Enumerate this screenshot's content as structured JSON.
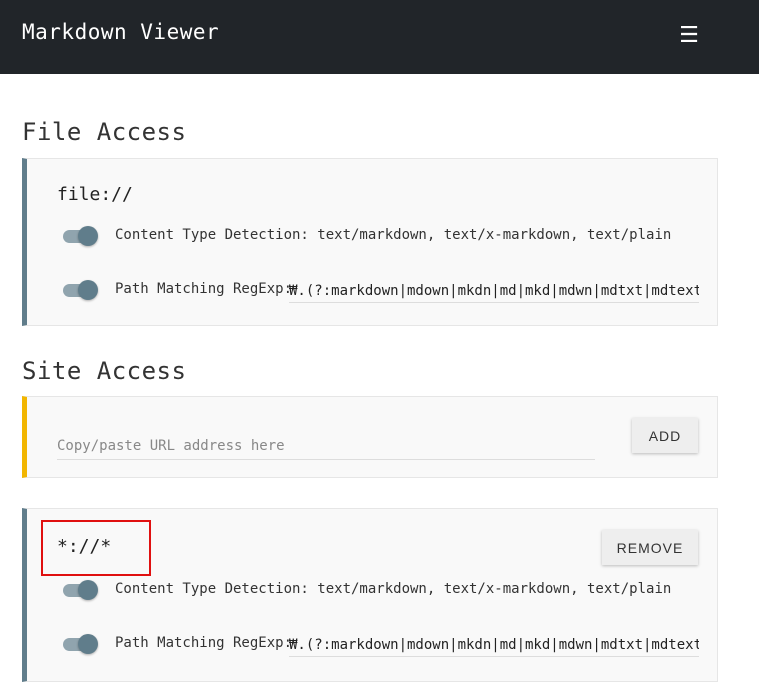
{
  "header": {
    "title": "Markdown Viewer",
    "menu_icon": "hamburger-menu-icon",
    "menu_glyph": "☰"
  },
  "file_access": {
    "title": "File Access",
    "origin": "file://",
    "options": [
      {
        "label": "Content Type Detection: text/markdown, text/x-markdown, text/plain",
        "enabled": true
      },
      {
        "label": "Path Matching RegExp:",
        "value": "₩.(?:markdown|mdown|mkdn|md|mkd|mdwn|mdtxt|mdtext|",
        "enabled": true
      }
    ]
  },
  "site_access": {
    "title": "Site Access",
    "placeholder": "Copy/paste URL address here",
    "add_label": "ADD",
    "origins": [
      {
        "origin": "*://*",
        "remove_label": "REMOVE",
        "options": [
          {
            "label": "Content Type Detection: text/markdown, text/x-markdown, text/plain",
            "enabled": true
          },
          {
            "label": "Path Matching RegExp:",
            "value": "₩.(?:markdown|mdown|mkdn|md|mkd|mdwn|mdtxt|mdtext|",
            "enabled": true
          }
        ]
      }
    ]
  },
  "colors": {
    "header_bg": "#212529",
    "accent": "#607d8b",
    "warning": "#f2b600",
    "highlight": "#e01010"
  }
}
